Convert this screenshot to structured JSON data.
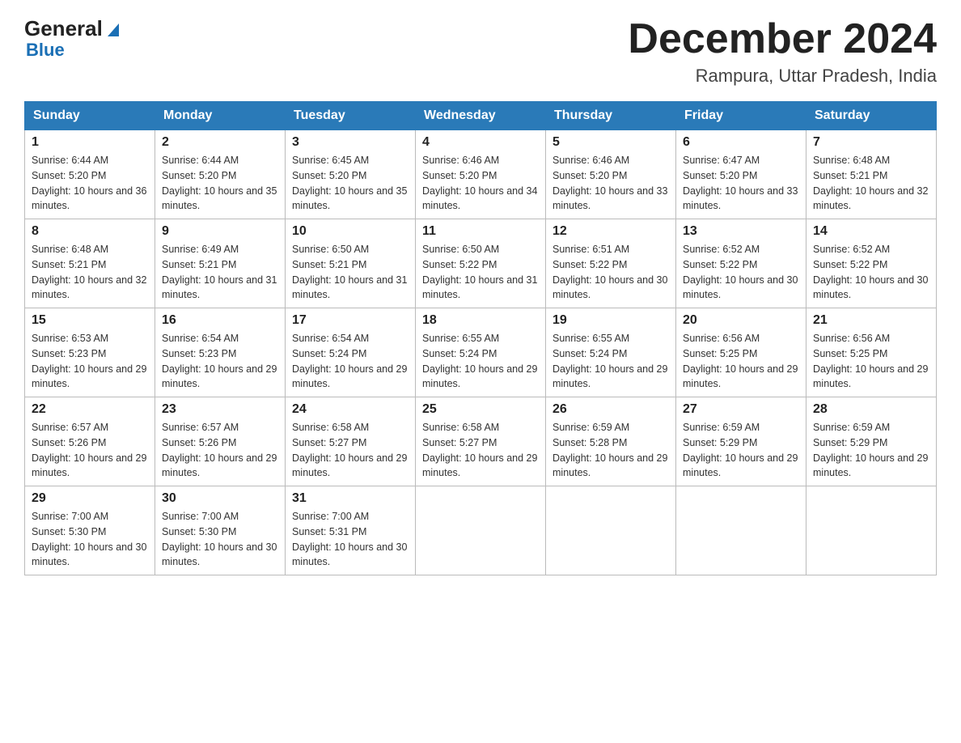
{
  "header": {
    "logo_general": "General",
    "logo_arrow": "▶",
    "logo_blue": "Blue",
    "month_title": "December 2024",
    "location": "Rampura, Uttar Pradesh, India"
  },
  "days_of_week": [
    "Sunday",
    "Monday",
    "Tuesday",
    "Wednesday",
    "Thursday",
    "Friday",
    "Saturday"
  ],
  "weeks": [
    [
      {
        "day": "1",
        "sunrise": "Sunrise: 6:44 AM",
        "sunset": "Sunset: 5:20 PM",
        "daylight": "Daylight: 10 hours and 36 minutes."
      },
      {
        "day": "2",
        "sunrise": "Sunrise: 6:44 AM",
        "sunset": "Sunset: 5:20 PM",
        "daylight": "Daylight: 10 hours and 35 minutes."
      },
      {
        "day": "3",
        "sunrise": "Sunrise: 6:45 AM",
        "sunset": "Sunset: 5:20 PM",
        "daylight": "Daylight: 10 hours and 35 minutes."
      },
      {
        "day": "4",
        "sunrise": "Sunrise: 6:46 AM",
        "sunset": "Sunset: 5:20 PM",
        "daylight": "Daylight: 10 hours and 34 minutes."
      },
      {
        "day": "5",
        "sunrise": "Sunrise: 6:46 AM",
        "sunset": "Sunset: 5:20 PM",
        "daylight": "Daylight: 10 hours and 33 minutes."
      },
      {
        "day": "6",
        "sunrise": "Sunrise: 6:47 AM",
        "sunset": "Sunset: 5:20 PM",
        "daylight": "Daylight: 10 hours and 33 minutes."
      },
      {
        "day": "7",
        "sunrise": "Sunrise: 6:48 AM",
        "sunset": "Sunset: 5:21 PM",
        "daylight": "Daylight: 10 hours and 32 minutes."
      }
    ],
    [
      {
        "day": "8",
        "sunrise": "Sunrise: 6:48 AM",
        "sunset": "Sunset: 5:21 PM",
        "daylight": "Daylight: 10 hours and 32 minutes."
      },
      {
        "day": "9",
        "sunrise": "Sunrise: 6:49 AM",
        "sunset": "Sunset: 5:21 PM",
        "daylight": "Daylight: 10 hours and 31 minutes."
      },
      {
        "day": "10",
        "sunrise": "Sunrise: 6:50 AM",
        "sunset": "Sunset: 5:21 PM",
        "daylight": "Daylight: 10 hours and 31 minutes."
      },
      {
        "day": "11",
        "sunrise": "Sunrise: 6:50 AM",
        "sunset": "Sunset: 5:22 PM",
        "daylight": "Daylight: 10 hours and 31 minutes."
      },
      {
        "day": "12",
        "sunrise": "Sunrise: 6:51 AM",
        "sunset": "Sunset: 5:22 PM",
        "daylight": "Daylight: 10 hours and 30 minutes."
      },
      {
        "day": "13",
        "sunrise": "Sunrise: 6:52 AM",
        "sunset": "Sunset: 5:22 PM",
        "daylight": "Daylight: 10 hours and 30 minutes."
      },
      {
        "day": "14",
        "sunrise": "Sunrise: 6:52 AM",
        "sunset": "Sunset: 5:22 PM",
        "daylight": "Daylight: 10 hours and 30 minutes."
      }
    ],
    [
      {
        "day": "15",
        "sunrise": "Sunrise: 6:53 AM",
        "sunset": "Sunset: 5:23 PM",
        "daylight": "Daylight: 10 hours and 29 minutes."
      },
      {
        "day": "16",
        "sunrise": "Sunrise: 6:54 AM",
        "sunset": "Sunset: 5:23 PM",
        "daylight": "Daylight: 10 hours and 29 minutes."
      },
      {
        "day": "17",
        "sunrise": "Sunrise: 6:54 AM",
        "sunset": "Sunset: 5:24 PM",
        "daylight": "Daylight: 10 hours and 29 minutes."
      },
      {
        "day": "18",
        "sunrise": "Sunrise: 6:55 AM",
        "sunset": "Sunset: 5:24 PM",
        "daylight": "Daylight: 10 hours and 29 minutes."
      },
      {
        "day": "19",
        "sunrise": "Sunrise: 6:55 AM",
        "sunset": "Sunset: 5:24 PM",
        "daylight": "Daylight: 10 hours and 29 minutes."
      },
      {
        "day": "20",
        "sunrise": "Sunrise: 6:56 AM",
        "sunset": "Sunset: 5:25 PM",
        "daylight": "Daylight: 10 hours and 29 minutes."
      },
      {
        "day": "21",
        "sunrise": "Sunrise: 6:56 AM",
        "sunset": "Sunset: 5:25 PM",
        "daylight": "Daylight: 10 hours and 29 minutes."
      }
    ],
    [
      {
        "day": "22",
        "sunrise": "Sunrise: 6:57 AM",
        "sunset": "Sunset: 5:26 PM",
        "daylight": "Daylight: 10 hours and 29 minutes."
      },
      {
        "day": "23",
        "sunrise": "Sunrise: 6:57 AM",
        "sunset": "Sunset: 5:26 PM",
        "daylight": "Daylight: 10 hours and 29 minutes."
      },
      {
        "day": "24",
        "sunrise": "Sunrise: 6:58 AM",
        "sunset": "Sunset: 5:27 PM",
        "daylight": "Daylight: 10 hours and 29 minutes."
      },
      {
        "day": "25",
        "sunrise": "Sunrise: 6:58 AM",
        "sunset": "Sunset: 5:27 PM",
        "daylight": "Daylight: 10 hours and 29 minutes."
      },
      {
        "day": "26",
        "sunrise": "Sunrise: 6:59 AM",
        "sunset": "Sunset: 5:28 PM",
        "daylight": "Daylight: 10 hours and 29 minutes."
      },
      {
        "day": "27",
        "sunrise": "Sunrise: 6:59 AM",
        "sunset": "Sunset: 5:29 PM",
        "daylight": "Daylight: 10 hours and 29 minutes."
      },
      {
        "day": "28",
        "sunrise": "Sunrise: 6:59 AM",
        "sunset": "Sunset: 5:29 PM",
        "daylight": "Daylight: 10 hours and 29 minutes."
      }
    ],
    [
      {
        "day": "29",
        "sunrise": "Sunrise: 7:00 AM",
        "sunset": "Sunset: 5:30 PM",
        "daylight": "Daylight: 10 hours and 30 minutes."
      },
      {
        "day": "30",
        "sunrise": "Sunrise: 7:00 AM",
        "sunset": "Sunset: 5:30 PM",
        "daylight": "Daylight: 10 hours and 30 minutes."
      },
      {
        "day": "31",
        "sunrise": "Sunrise: 7:00 AM",
        "sunset": "Sunset: 5:31 PM",
        "daylight": "Daylight: 10 hours and 30 minutes."
      },
      null,
      null,
      null,
      null
    ]
  ]
}
